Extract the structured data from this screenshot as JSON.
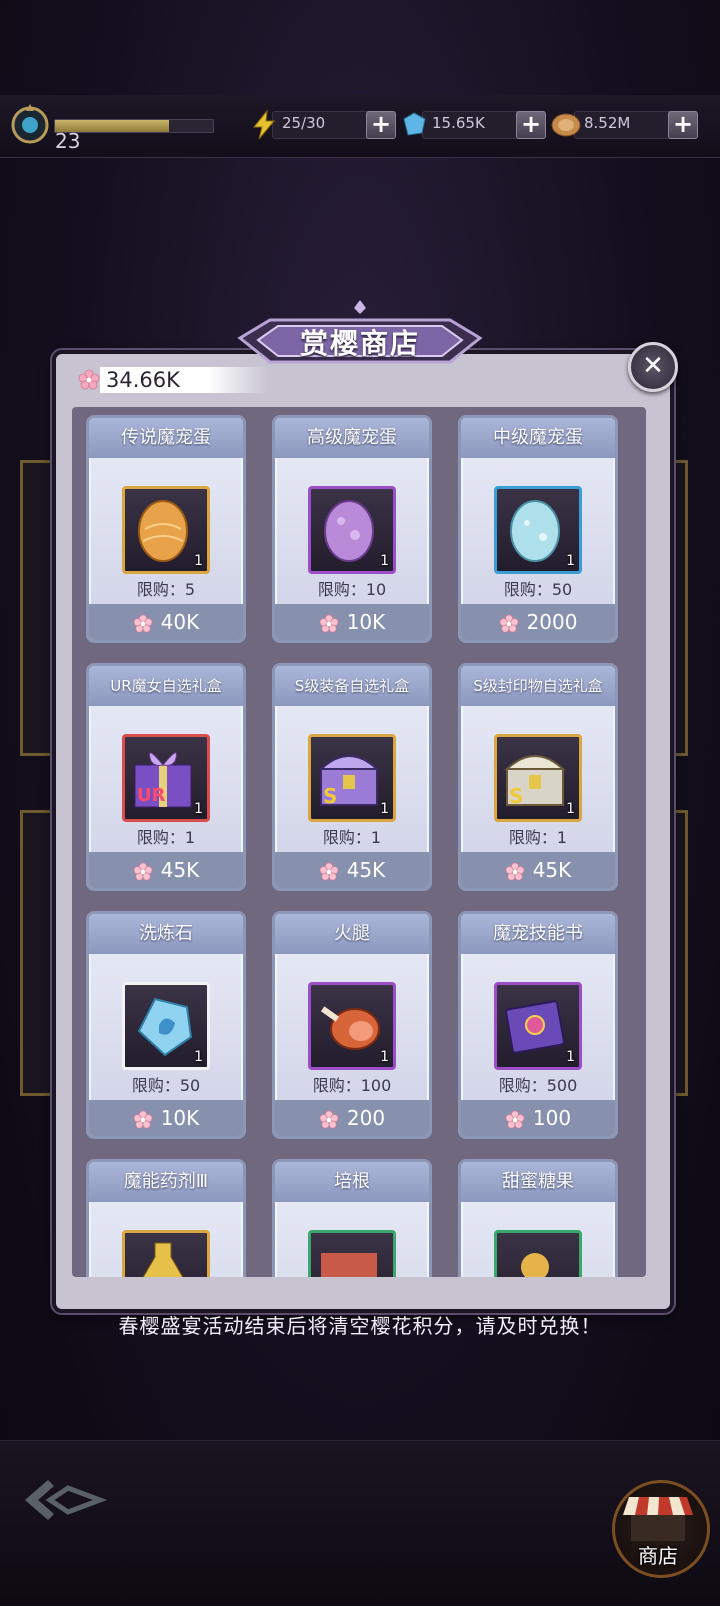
{
  "header": {
    "level": "23",
    "xp_fraction": 0.72,
    "energy": "25/30",
    "gems": "15.65K",
    "coins": "8.52M"
  },
  "shop": {
    "title": "赏樱商店",
    "points": "34.66K",
    "items": [
      {
        "name": "传说魔宠蛋",
        "qty": "1",
        "limit": "限购：5",
        "price": "40K",
        "icon": "golden-egg",
        "frame": "#d9a640"
      },
      {
        "name": "高级魔宠蛋",
        "qty": "1",
        "limit": "限购：10",
        "price": "10K",
        "icon": "purple-egg",
        "frame": "#9a4fc7"
      },
      {
        "name": "中级魔宠蛋",
        "qty": "1",
        "limit": "限购：50",
        "price": "2000",
        "icon": "blue-egg",
        "frame": "#3a9ed4"
      },
      {
        "name": "UR魔女自选礼盒",
        "qty": "1",
        "limit": "限购：1",
        "price": "45K",
        "icon": "ur-gift-box",
        "frame": "#d94d4d"
      },
      {
        "name": "S级装备自选礼盒",
        "qty": "1",
        "limit": "限购：1",
        "price": "45K",
        "icon": "s-equipment-chest",
        "frame": "#d9a640"
      },
      {
        "name": "S级封印物自选礼盒",
        "qty": "1",
        "limit": "限购：1",
        "price": "45K",
        "icon": "s-seal-chest",
        "frame": "#d9a640"
      },
      {
        "name": "洗炼石",
        "qty": "1",
        "limit": "限购：50",
        "price": "10K",
        "icon": "refine-stone",
        "frame": "#f2f2f2"
      },
      {
        "name": "火腿",
        "qty": "1",
        "limit": "限购：100",
        "price": "200",
        "icon": "ham",
        "frame": "#9a4fc7"
      },
      {
        "name": "魔宠技能书",
        "qty": "1",
        "limit": "限购：500",
        "price": "100",
        "icon": "skill-book",
        "frame": "#9a4fc7"
      },
      {
        "name": "魔能药剂Ⅲ",
        "qty": "",
        "limit": "",
        "price": "",
        "icon": "potion",
        "frame": "#d9a640"
      },
      {
        "name": "培根",
        "qty": "",
        "limit": "",
        "price": "",
        "icon": "bacon",
        "frame": "#3aa86a"
      },
      {
        "name": "甜蜜糖果",
        "qty": "",
        "limit": "",
        "price": "",
        "icon": "candy",
        "frame": "#3aa86a"
      }
    ],
    "notice": "春樱盛宴活动结束后将清空樱花积分，请及时兑换！"
  },
  "nav": {
    "shop_label": "商店"
  },
  "colors": {
    "panel_bg": "#c7c3d1",
    "card_header": "#9aa5cc",
    "price_bar": "#8790ad",
    "blossom": "#f5a9bd"
  }
}
